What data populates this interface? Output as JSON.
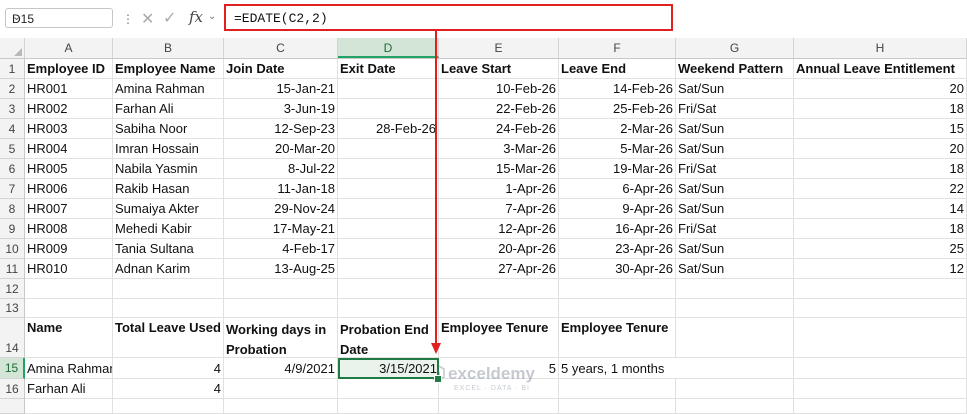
{
  "name_box": {
    "value": "D15"
  },
  "formula_bar": {
    "formula": "=EDATE(C2,2)",
    "fx_label": "fx"
  },
  "columns": [
    "A",
    "B",
    "C",
    "D",
    "E",
    "F",
    "G",
    "H"
  ],
  "rows": [
    "1",
    "2",
    "3",
    "4",
    "5",
    "6",
    "7",
    "8",
    "9",
    "10",
    "11",
    "12",
    "13",
    "14",
    "15",
    "16"
  ],
  "table1": {
    "headers": [
      "Employee ID",
      "Employee Name",
      "Join Date",
      "Exit Date",
      "Leave Start",
      "Leave End",
      "Weekend Pattern",
      "Annual Leave Entitlement"
    ],
    "rows": [
      [
        "HR001",
        "Amina Rahman",
        "15-Jan-21",
        "",
        "10-Feb-26",
        "14-Feb-26",
        "Sat/Sun",
        "20"
      ],
      [
        "HR002",
        "Farhan Ali",
        "3-Jun-19",
        "",
        "22-Feb-26",
        "25-Feb-26",
        "Fri/Sat",
        "18"
      ],
      [
        "HR003",
        "Sabiha Noor",
        "12-Sep-23",
        "28-Feb-26",
        "24-Feb-26",
        "2-Mar-26",
        "Sat/Sun",
        "15"
      ],
      [
        "HR004",
        "Imran Hossain",
        "20-Mar-20",
        "",
        "3-Mar-26",
        "5-Mar-26",
        "Sat/Sun",
        "20"
      ],
      [
        "HR005",
        "Nabila Yasmin",
        "8-Jul-22",
        "",
        "15-Mar-26",
        "19-Mar-26",
        "Fri/Sat",
        "18"
      ],
      [
        "HR006",
        "Rakib Hasan",
        "11-Jan-18",
        "",
        "1-Apr-26",
        "6-Apr-26",
        "Sat/Sun",
        "22"
      ],
      [
        "HR007",
        "Sumaiya Akter",
        "29-Nov-24",
        "",
        "7-Apr-26",
        "9-Apr-26",
        "Sat/Sun",
        "14"
      ],
      [
        "HR008",
        "Mehedi Kabir",
        "17-May-21",
        "",
        "12-Apr-26",
        "16-Apr-26",
        "Fri/Sat",
        "18"
      ],
      [
        "HR009",
        "Tania Sultana",
        "4-Feb-17",
        "",
        "20-Apr-26",
        "23-Apr-26",
        "Sat/Sun",
        "25"
      ],
      [
        "HR010",
        "Adnan Karim",
        "13-Aug-25",
        "",
        "27-Apr-26",
        "30-Apr-26",
        "Sat/Sun",
        "12"
      ]
    ]
  },
  "table2": {
    "headers": {
      "name": "Name",
      "total_leave": "Total Leave Used",
      "working_days_l1": "Working days in",
      "working_days_l2": "Probation",
      "probation_l1": "Probation End",
      "probation_l2": "Date",
      "tenure1": "Employee Tenure",
      "tenure2": "Employee Tenure"
    },
    "row15": {
      "name": "Amina Rahman",
      "total_leave": "4",
      "working_days": "4/9/2021",
      "probation_end": "3/15/2021",
      "tenure1": "5",
      "tenure2": "5 years, 1 months"
    },
    "row16": {
      "name": "Farhan Ali",
      "total_leave": "4"
    }
  },
  "watermark": {
    "name": "exceldemy",
    "tagline": "EXCEL · DATA · BI"
  },
  "colors": {
    "highlight": "#e0201f",
    "selection": "#1f7a44"
  }
}
